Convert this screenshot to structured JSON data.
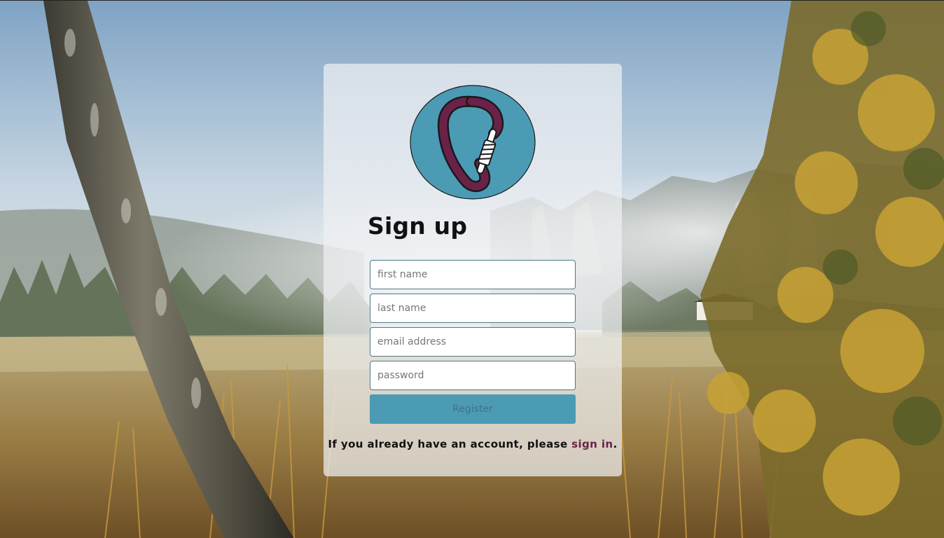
{
  "form": {
    "title": "Sign up",
    "first_name_placeholder": "first name",
    "last_name_placeholder": "last name",
    "email_placeholder": "email address",
    "password_placeholder": "password",
    "register_label": "Register"
  },
  "footer": {
    "prefix": "If you already have an account, please ",
    "link_text": "sign in",
    "suffix": "."
  },
  "colors": {
    "logo_circle": "#4b9bb5",
    "carabiner": "#6b2249",
    "register_button": "#4b9bb5",
    "link": "#6b2249"
  },
  "icons": {
    "logo": "carabiner-logo-icon",
    "background": "forest-meadow-background"
  }
}
